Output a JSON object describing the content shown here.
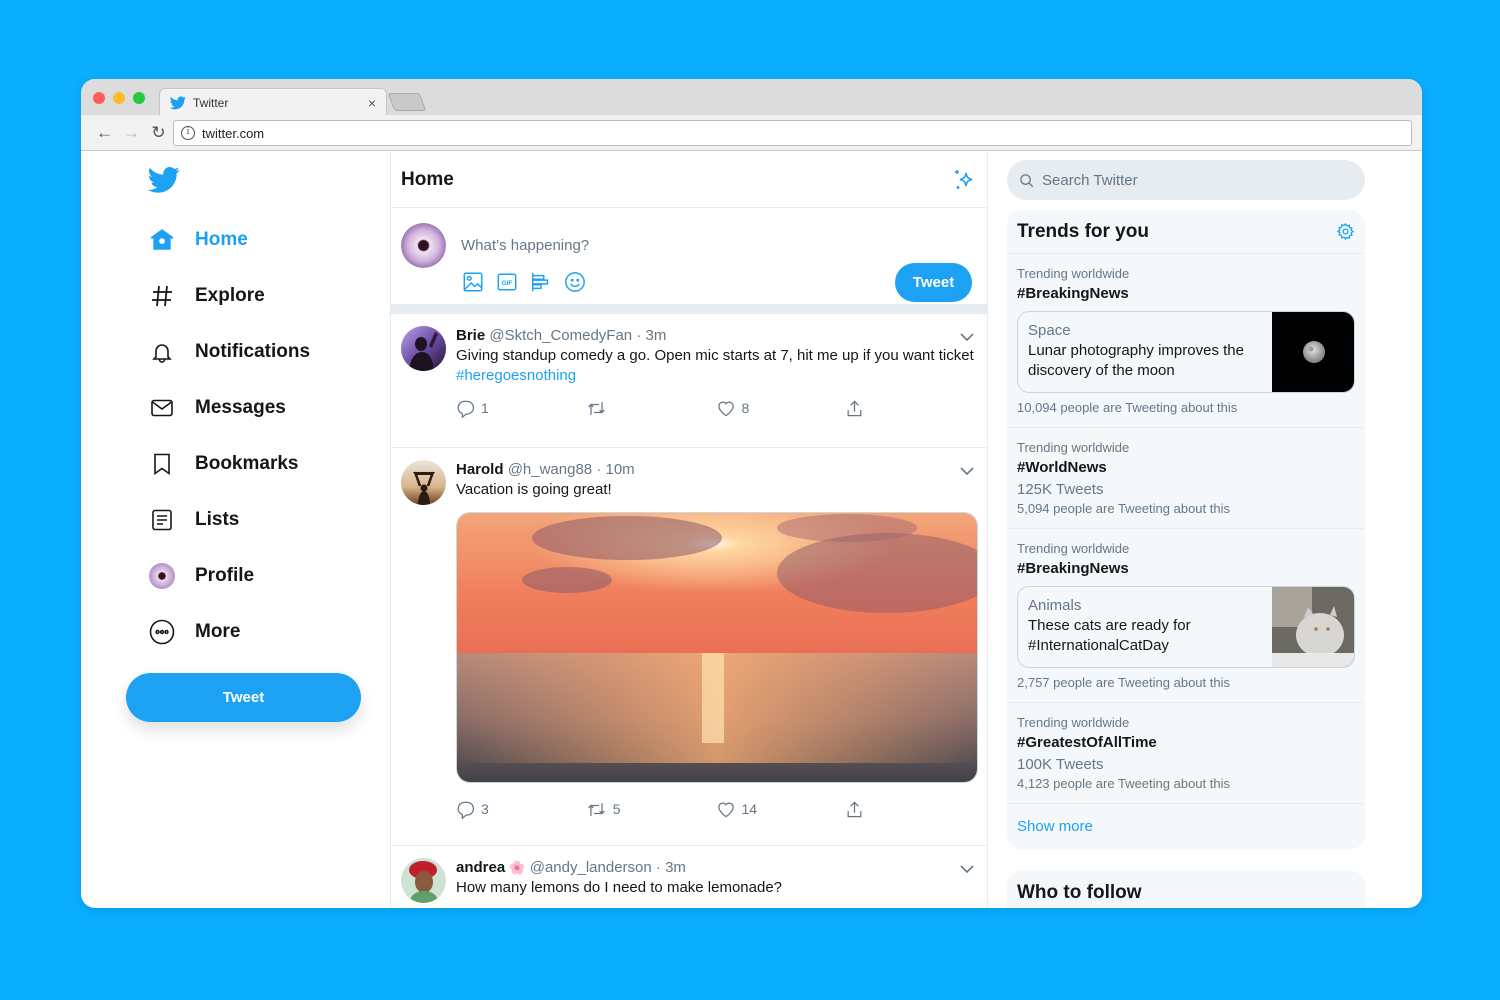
{
  "browser": {
    "tab_title": "Twitter",
    "address": "twitter.com",
    "traffic_lights": [
      "#fc5f57",
      "#fdbc2e",
      "#28c840"
    ]
  },
  "colors": {
    "accent": "#1da1f2",
    "background": "#0aaeff",
    "border": "#e6ecf0",
    "muted": "#657786"
  },
  "nav": {
    "items": [
      {
        "label": "Home",
        "icon": "home-icon",
        "active": true
      },
      {
        "label": "Explore",
        "icon": "hashtag-icon"
      },
      {
        "label": "Notifications",
        "icon": "bell-icon"
      },
      {
        "label": "Messages",
        "icon": "envelope-icon"
      },
      {
        "label": "Bookmarks",
        "icon": "bookmark-icon"
      },
      {
        "label": "Lists",
        "icon": "list-icon"
      },
      {
        "label": "Profile",
        "icon": "avatar"
      },
      {
        "label": "More",
        "icon": "more-icon"
      }
    ],
    "tweet_button": "Tweet"
  },
  "timeline": {
    "title": "Home",
    "compose": {
      "placeholder": "What’s happening?",
      "tools": [
        "image-icon",
        "gif-icon",
        "poll-icon",
        "emoji-icon"
      ],
      "tweet_button": "Tweet"
    },
    "tweets": [
      {
        "name": "Brie",
        "handle": "@Sktch_ComedyFan",
        "time": "3m",
        "text": "Giving standup comedy a go. Open mic starts at 7, hit me up if you want ticket ",
        "hashtag": "#heregoesnothing",
        "replies": "1",
        "retweets": "",
        "likes": "8"
      },
      {
        "name": "Harold",
        "handle": "@h_wang88",
        "time": "10m",
        "text": "Vacation is going great!",
        "media": "sunset over the sea",
        "replies": "3",
        "retweets": "5",
        "likes": "14"
      },
      {
        "name": "andrea",
        "emoji": "🌸",
        "handle": "@andy_landerson",
        "time": "3m",
        "text": "How many lemons do I need to make lemonade?"
      }
    ]
  },
  "sidebar": {
    "search_placeholder": "Search Twitter",
    "trends_title": "Trends for you",
    "trends": [
      {
        "context": "Trending worldwide",
        "tag": "#BreakingNews",
        "card": {
          "category": "Space",
          "headline": "Lunar photography improves the discovery of the moon"
        },
        "people": "10,094 people are Tweeting about this"
      },
      {
        "context": "Trending worldwide",
        "tag": "#WorldNews",
        "count": "125K Tweets",
        "people": "5,094 people are Tweeting about this"
      },
      {
        "context": "Trending worldwide",
        "tag": "#BreakingNews",
        "card": {
          "category": "Animals",
          "headline": "These cats are ready for #InternationalCatDay"
        },
        "people": "2,757 people are Tweeting about this"
      },
      {
        "context": "Trending worldwide",
        "tag": "#GreatestOfAllTime",
        "count": "100K Tweets",
        "people": "4,123 people are Tweeting about this"
      }
    ],
    "show_more": "Show more",
    "who_to_follow": "Who to follow"
  }
}
